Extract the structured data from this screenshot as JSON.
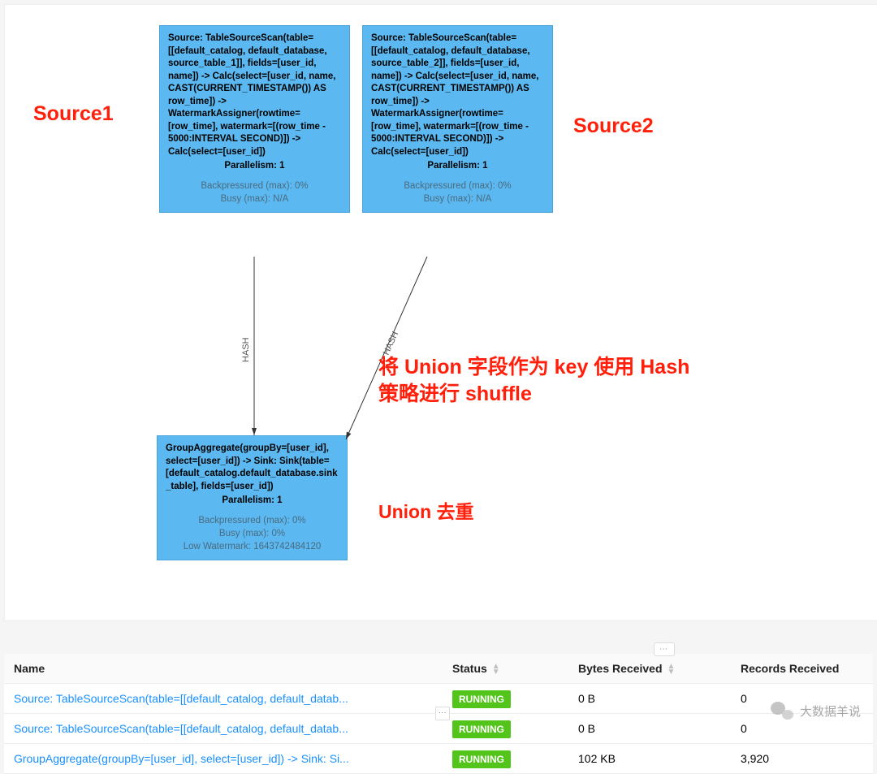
{
  "annotations": {
    "source1": "Source1",
    "source2": "Source2",
    "hash": "将 Union 字段作为 key 使用 Hash\n策略进行 shuffle",
    "union": "Union 去重"
  },
  "nodes": {
    "n1": {
      "desc": "Source: TableSourceScan(table=[[default_catalog, default_database, source_table_1]], fields=[user_id, name]) -> Calc(select=[user_id, name, CAST(CURRENT_TIMESTAMP()) AS row_time]) -> WatermarkAssigner(rowtime=[row_time], watermark=[(row_time - 5000:INTERVAL SECOND)]) -> Calc(select=[user_id])",
      "parallelism": "Parallelism: 1",
      "backpressure": "Backpressured (max): 0%",
      "busy": "Busy (max): N/A"
    },
    "n2": {
      "desc": "Source: TableSourceScan(table=[[default_catalog, default_database, source_table_2]], fields=[user_id, name]) -> Calc(select=[user_id, name, CAST(CURRENT_TIMESTAMP()) AS row_time]) -> WatermarkAssigner(rowtime=[row_time], watermark=[(row_time - 5000:INTERVAL SECOND)]) -> Calc(select=[user_id])",
      "parallelism": "Parallelism: 1",
      "backpressure": "Backpressured (max): 0%",
      "busy": "Busy (max): N/A"
    },
    "n3": {
      "desc": "GroupAggregate(groupBy=[user_id], select=[user_id]) -> Sink: Sink(table=[default_catalog.default_database.sink_table], fields=[user_id])",
      "parallelism": "Parallelism: 1",
      "backpressure": "Backpressured (max): 0%",
      "busy": "Busy (max): 0%",
      "watermark": "Low Watermark: 1643742484120"
    }
  },
  "edges": {
    "label1": "HASH",
    "label2": "HASH"
  },
  "table": {
    "headers": {
      "name": "Name",
      "status": "Status",
      "bytes": "Bytes Received",
      "records": "Records Received"
    },
    "rows": [
      {
        "name": "Source: TableSourceScan(table=[[default_catalog, default_datab...",
        "status": "RUNNING",
        "bytes": "0 B",
        "records": "0"
      },
      {
        "name": "Source: TableSourceScan(table=[[default_catalog, default_datab...",
        "status": "RUNNING",
        "bytes": "0 B",
        "records": "0"
      },
      {
        "name": "GroupAggregate(groupBy=[user_id], select=[user_id]) -> Sink: Si...",
        "status": "RUNNING",
        "bytes": "102 KB",
        "records": "3,920"
      }
    ]
  },
  "watermark": "大数据羊说"
}
